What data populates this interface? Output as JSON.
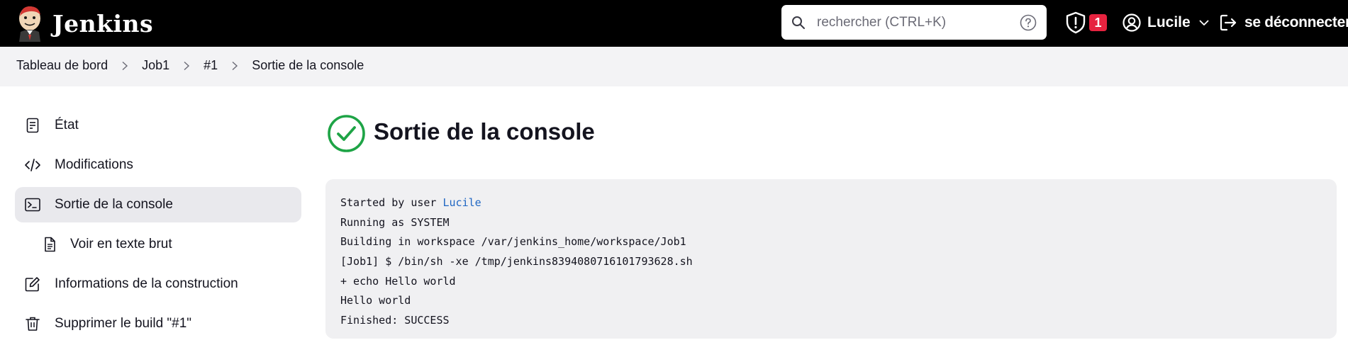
{
  "header": {
    "brand": "Jenkins",
    "search": {
      "placeholder": "rechercher (CTRL+K)",
      "value": ""
    },
    "security_badge_count": "1",
    "user_name": "Lucile",
    "logout_label": "se déconnecter",
    "colors": {
      "background": "#000000",
      "badge": "#e6233f"
    }
  },
  "breadcrumb": {
    "items": [
      "Tableau de bord",
      "Job1",
      "#1",
      "Sortie de la console"
    ]
  },
  "sidebar": {
    "items": [
      {
        "label": "État",
        "icon": "document-icon",
        "active": false
      },
      {
        "label": "Modifications",
        "icon": "code-icon",
        "active": false
      },
      {
        "label": "Sortie de la console",
        "icon": "terminal-icon",
        "active": true
      },
      {
        "label": "Voir en texte brut",
        "icon": "file-text-icon",
        "active": false,
        "sub": true
      },
      {
        "label": "Informations de la construction",
        "icon": "edit-icon",
        "active": false
      },
      {
        "label": "Supprimer le build \"#1\"",
        "icon": "trash-icon",
        "active": false
      }
    ]
  },
  "main": {
    "title": "Sortie de la console",
    "status": "success",
    "status_color": "#1ea446",
    "console": {
      "started_prefix": "Started by user ",
      "started_user": "Lucile",
      "lines": [
        "Running as SYSTEM",
        "Building in workspace /var/jenkins_home/workspace/Job1",
        "[Job1] $ /bin/sh -xe /tmp/jenkins8394080716101793628.sh",
        "+ echo Hello world",
        "Hello world",
        "Finished: SUCCESS"
      ]
    }
  }
}
